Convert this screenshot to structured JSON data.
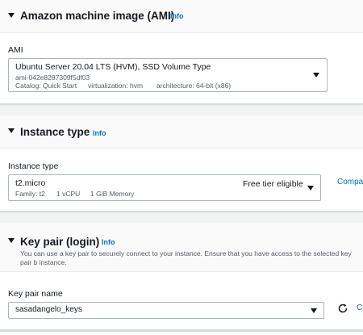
{
  "ami_section": {
    "title": "Amazon machine image (AMI)",
    "info": "Info",
    "field_label": "AMI",
    "selected_name": "Ubuntu Server 20.04 LTS (HVM), SSD Volume Type",
    "ami_id": "ami-042e8287309f5df03",
    "catalog": "Catalog: Quick Start",
    "virtualization": "virtualization: hvm",
    "architecture": "architecture: 64-bit (x86)"
  },
  "instance_section": {
    "title": "Instance type",
    "info": "Info",
    "field_label": "Instance type",
    "selected_type": "t2.micro",
    "family": "Family: t2",
    "vcpu": "1 vCPU",
    "memory": "1 GiB Memory",
    "free_tier": "Free tier eligible",
    "compare_link": "Compa"
  },
  "keypair_section": {
    "title": "Key pair (login)",
    "info": "Info",
    "description": "You can use a key pair to securely connect to your instance. Ensure that you have access to the selected key pair b instance.",
    "field_label": "Key pair name",
    "selected_key": "sasadangelo_keys",
    "create_link": "C"
  },
  "colors": {
    "link": "#0073bb",
    "background": "#f2f3f3",
    "panel": "#ffffff",
    "border": "#aab7b8"
  },
  "icons": [
    "caret-down-icon",
    "refresh-icon"
  ]
}
